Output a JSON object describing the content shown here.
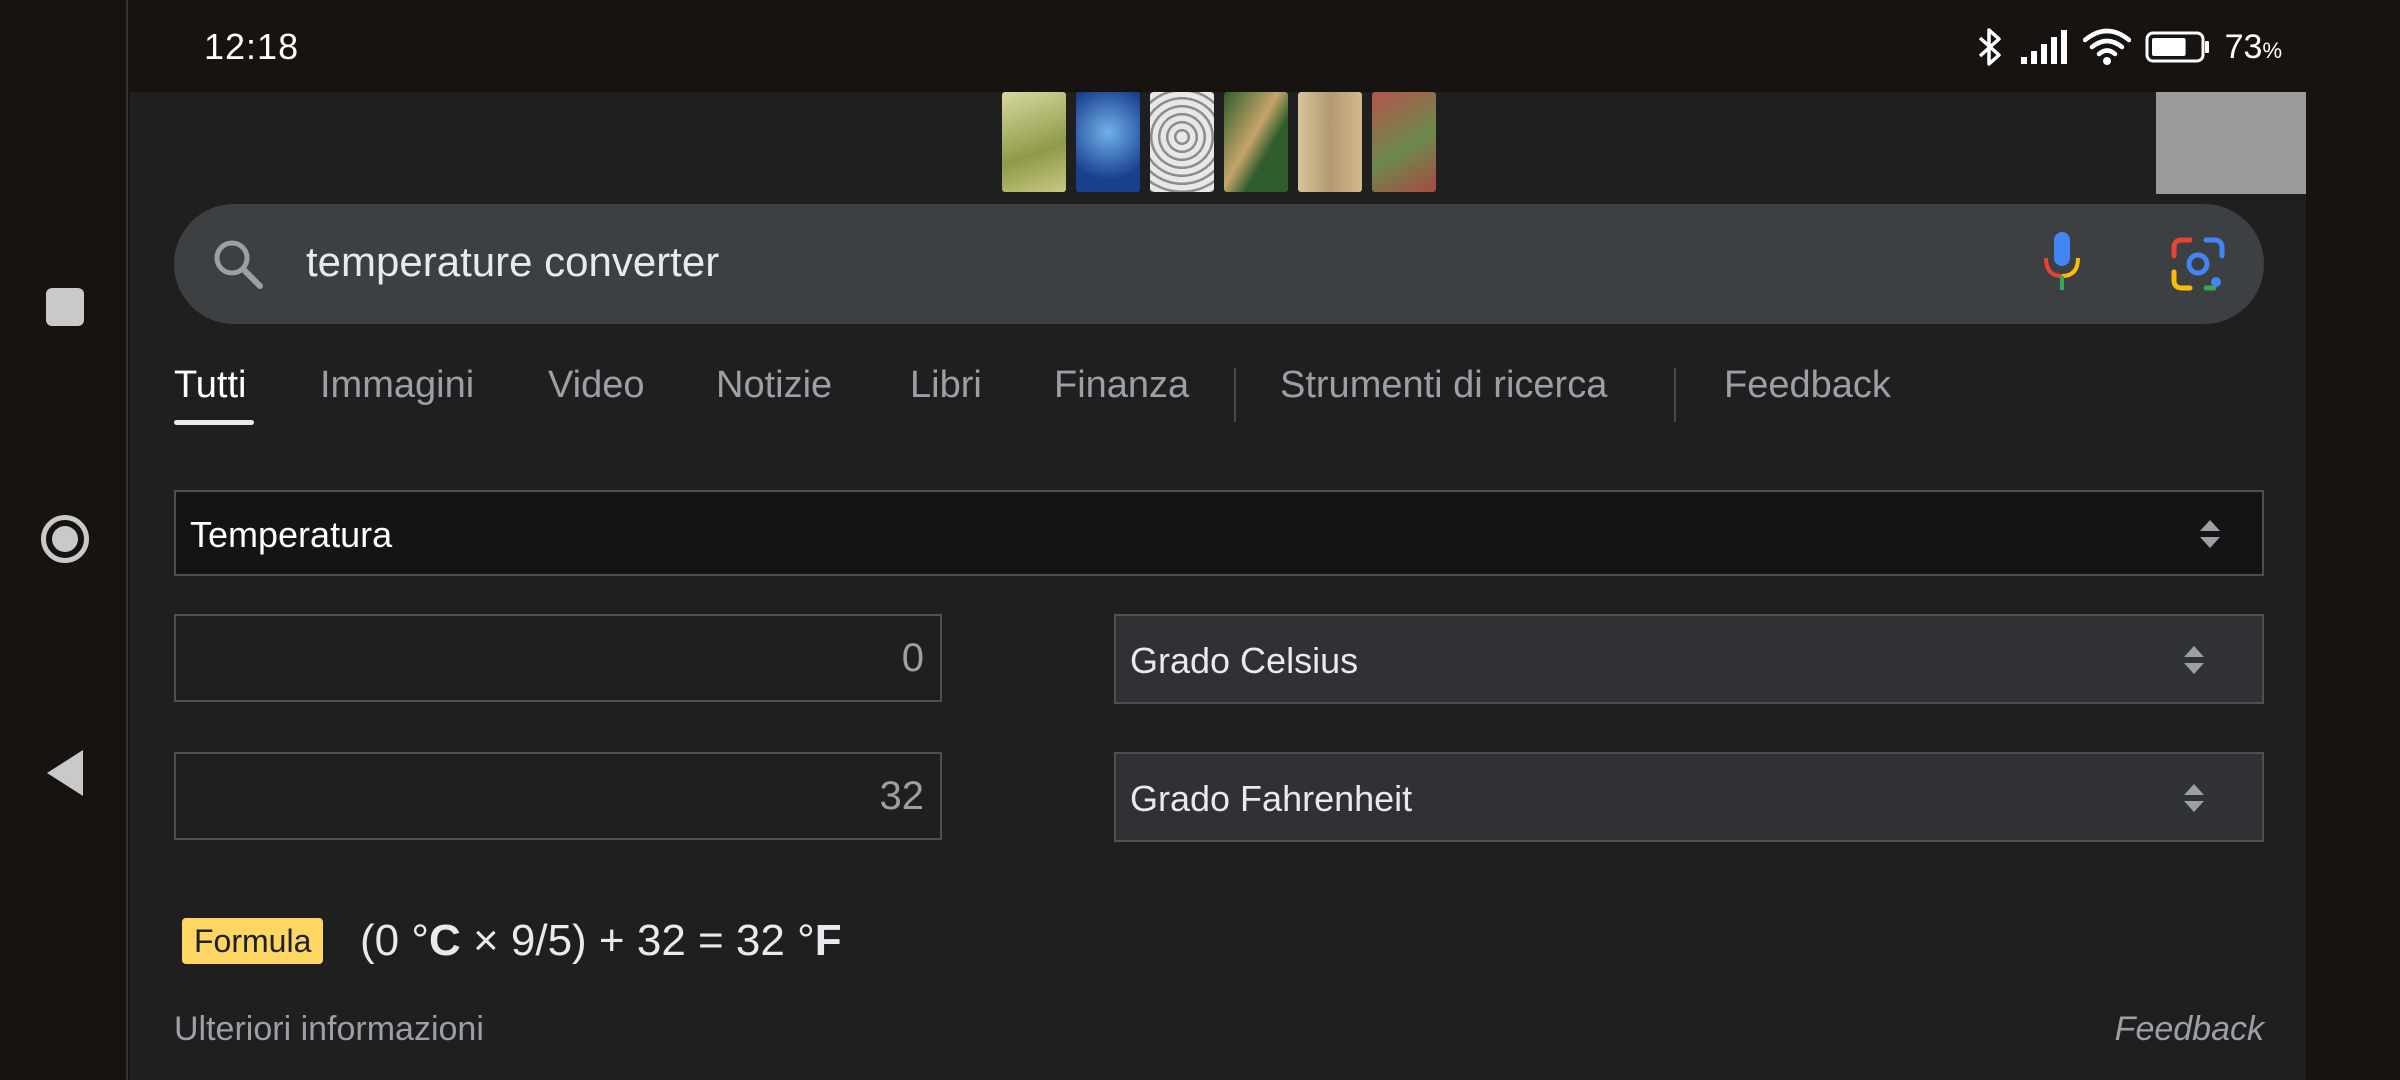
{
  "status_bar": {
    "time": "12:18",
    "battery_percent": "73",
    "battery_symbol": "%",
    "battery_level": 0.73,
    "icons": [
      "bluetooth-icon",
      "signal-icon",
      "wifi-icon",
      "battery-icon"
    ]
  },
  "search": {
    "query": "temperature converter"
  },
  "tabs": [
    {
      "label": "Tutti",
      "active": true
    },
    {
      "label": "Immagini"
    },
    {
      "label": "Video"
    },
    {
      "label": "Notizie"
    },
    {
      "label": "Libri"
    },
    {
      "label": "Finanza"
    },
    {
      "label": "Strumenti di ricerca"
    },
    {
      "label": "Feedback"
    }
  ],
  "converter": {
    "category": "Temperatura",
    "from_value": "0",
    "from_unit": "Grado Celsius",
    "to_value": "32",
    "to_unit": "Grado Fahrenheit",
    "formula_badge": "Formula",
    "formula": {
      "part1": "(0 °",
      "unit1": "C",
      "part2": " × 9/5) + 32 = 32 °",
      "unit2": "F"
    }
  },
  "footer": {
    "more_info": "Ulteriori informazioni",
    "feedback": "Feedback"
  },
  "colors": {
    "accent_badge": "#fdd663",
    "search_bg": "#3c4043",
    "page_bg": "#1f1f1f"
  }
}
